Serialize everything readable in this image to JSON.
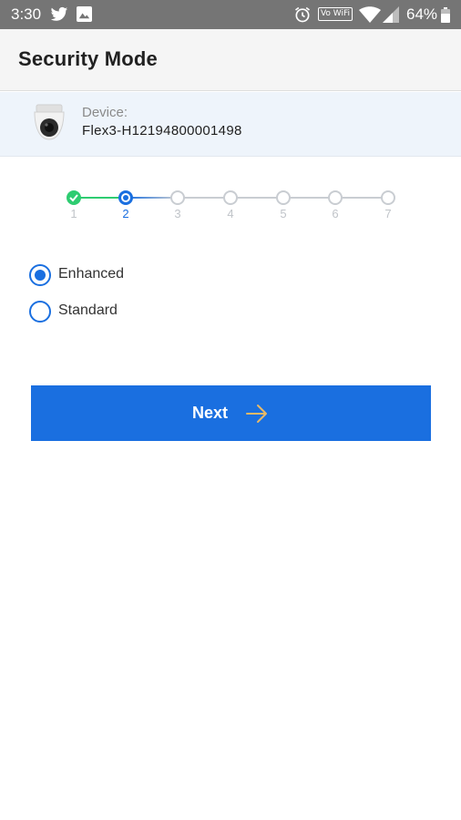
{
  "status_bar": {
    "time": "3:30",
    "wifi_call_label": "Vo WiFi",
    "battery_percent": "64%",
    "icons": [
      "twitter-icon",
      "image-icon",
      "alarm-icon",
      "wifi-icon",
      "signal-icon",
      "battery-icon"
    ]
  },
  "app_bar": {
    "title": "Security Mode"
  },
  "device": {
    "label": "Device:",
    "name": "Flex3-H12194800001498",
    "icon": "camera-icon"
  },
  "stepper": {
    "steps": [
      "1",
      "2",
      "3",
      "4",
      "5",
      "6",
      "7"
    ],
    "completed": [
      1
    ],
    "current": 2,
    "colors": {
      "done": "#2ecc71",
      "active": "#1a6fe0",
      "inactive": "#c9cdd2"
    }
  },
  "options": [
    {
      "label": "Enhanced",
      "selected": true
    },
    {
      "label": "Standard",
      "selected": false
    }
  ],
  "next_button": {
    "label": "Next",
    "icon": "arrow-right-icon",
    "color": "#1a6fe0"
  }
}
